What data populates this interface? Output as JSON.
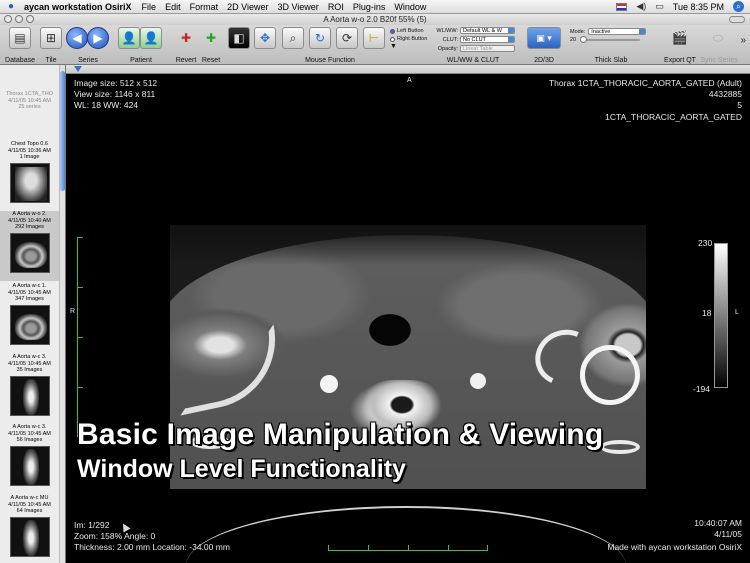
{
  "menubar": {
    "app_name": "aycan workstation OsiriX",
    "items": [
      "File",
      "Edit",
      "Format",
      "2D Viewer",
      "3D Viewer",
      "ROI",
      "Plug-ins",
      "Window"
    ],
    "clock": "Tue 8:35 PM"
  },
  "window": {
    "title": "A Aorta w-o  2.0  B20f  55% (5)"
  },
  "toolbar": {
    "database": "Database",
    "tile": "Tile",
    "series": "Series",
    "patient": "Patient",
    "revert": "Revert",
    "reset": "Reset",
    "mouse_function": "Mouse Function",
    "left_button": "Left Button",
    "right_button": "Right Button",
    "wlww_label": "WL/WW:",
    "wlww_value": "Default WL & W",
    "clut_label": "CLUT:",
    "clut_value": "No CLUT",
    "opacity_label": "Opacity:",
    "opacity_value": "Linear Table",
    "wlww_clut": "WL/WW & CLUT",
    "view_2d3d": "2D/3D",
    "mode_label": "Mode:",
    "mode_value": "Inactive",
    "slab_value": "20",
    "thick_slab": "Thick Slab",
    "export_qt": "Export QT",
    "sync_series": "Sync Series"
  },
  "sidebar": {
    "study": {
      "line1": "Thorax 1CTA_THO",
      "line2": "4/11/05 10:45 AM",
      "line3": "25 series"
    },
    "series": [
      {
        "name": "Chest Topo  0.6",
        "date": "4/11/05 10:36 AM",
        "count": "1 Image"
      },
      {
        "name": "A Aorta w-o  2.",
        "date": "4/11/05 10:40 AM",
        "count": "292 Images"
      },
      {
        "name": "A Aorta w-c  1.",
        "date": "4/11/05 10:45 AM",
        "count": "347 Images"
      },
      {
        "name": "A Aorta w-c  3.",
        "date": "4/11/05 10:45 AM",
        "count": "35 Images"
      },
      {
        "name": "A Aorta w-c  3.",
        "date": "4/11/05 10:45 AM",
        "count": "56 Images"
      },
      {
        "name": "A Aorta w-c  MU",
        "date": "4/11/05 10:45 AM",
        "count": "64 Images"
      }
    ]
  },
  "viewer": {
    "image_size": "Image size: 512 x 512",
    "view_size": "View size: 1146 x 811",
    "wl_ww": "WL: 18 WW: 424",
    "orient_top": "A",
    "orient_right_side": "L",
    "orient_left_side": "R",
    "patient_line": "Thorax 1CTA_THORACIC_AORTA_GATED (Adult)",
    "patient_id": "4432885",
    "series_no": "5",
    "study_desc": "1CTA_THORACIC_AORTA_GATED",
    "colorbar_max": "230",
    "colorbar_mid": "18",
    "colorbar_min": "-194",
    "im": "Im: 1/292",
    "zoom": "Zoom: 158% Angle: 0",
    "thickness": "Thickness: 2.00 mm Location: -34.00 mm",
    "time": "10:40:07 AM",
    "date": "4/11/05",
    "made_with": "Made with aycan workstation OsiriX"
  },
  "caption": {
    "line1": "Basic Image Manipulation & Viewing",
    "line2": "Window Level Functionality"
  }
}
